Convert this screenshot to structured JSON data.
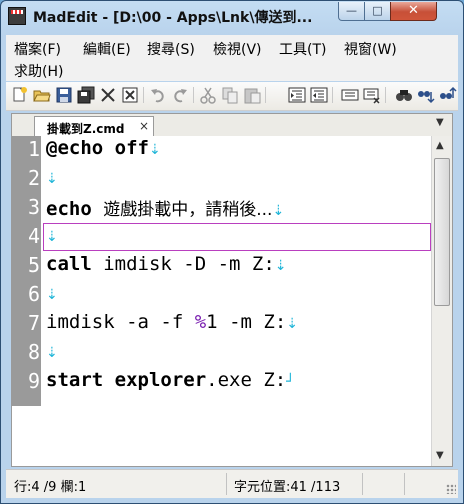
{
  "window": {
    "title": "MadEdit - [D:\\00 - Apps\\Lnk\\傳送到...",
    "minimize_glyph": "—",
    "maximize_glyph": "□",
    "close_glyph": "✕"
  },
  "menu": {
    "items": [
      {
        "label": "檔案(F)"
      },
      {
        "label": "編輯(E)"
      },
      {
        "label": "搜尋(S)"
      },
      {
        "label": "檢視(V)"
      },
      {
        "label": "工具(T)"
      },
      {
        "label": "視窗(W)"
      },
      {
        "label": "求助(H)"
      }
    ]
  },
  "toolbar": {
    "icons": [
      "new-file-icon",
      "open-file-icon",
      "save-icon",
      "save-all-icon",
      "close-file-icon",
      "close-all-icon",
      "undo-icon",
      "redo-icon",
      "cut-icon",
      "copy-icon",
      "paste-icon",
      "indent-icon",
      "unindent-icon",
      "comment-icon",
      "uncomment-icon",
      "find-icon",
      "find-next-icon",
      "find-prev-icon"
    ]
  },
  "tab": {
    "label": "掛載到Z.cmd",
    "close_glyph": "×",
    "menu_glyph": "▼"
  },
  "editor": {
    "current_line": 4,
    "lines": [
      {
        "num": "1"
      },
      {
        "num": "2"
      },
      {
        "num": "3"
      },
      {
        "num": "4"
      },
      {
        "num": "5"
      },
      {
        "num": "6"
      },
      {
        "num": "7"
      },
      {
        "num": "8"
      },
      {
        "num": "9"
      }
    ],
    "code": {
      "l1_at": "@",
      "l1_kw": "echo off",
      "l3_kw": "echo",
      "l3_text": "遊戲掛載中，請稍後...",
      "l5_kw": "call",
      "l5_rest": " imdisk -D -m Z:",
      "l7_pre": "imdisk -a -f ",
      "l7_pct": "%",
      "l7_num": "1",
      "l7_post": " -m Z:",
      "l9_kw": "start explorer",
      "l9_rest": ".exe Z:"
    },
    "eol_glyph": "⇣",
    "eof_glyph": "┘"
  },
  "status": {
    "position": "行:4 /9 欄:1",
    "char_position": "字元位置:41 /113"
  },
  "colors": {
    "gutter": "#9a9a9a",
    "current_line_border": "#b93fbf",
    "eol_marker": "#1fb5d8",
    "percent_var": "#7a1fb0"
  }
}
